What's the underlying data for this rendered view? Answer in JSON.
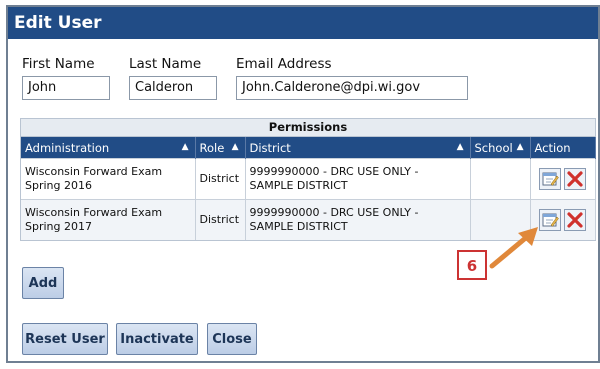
{
  "dialog": {
    "title": "Edit User"
  },
  "user": {
    "first_name_label": "First Name",
    "first_name_value": "John",
    "last_name_label": "Last Name",
    "last_name_value": "Calderon",
    "email_label": "Email Address",
    "email_value": "John.Calderone@dpi.wi.gov"
  },
  "permissions": {
    "title": "Permissions",
    "columns": [
      "Administration",
      "Role",
      "District",
      "School",
      "Action"
    ],
    "rows": [
      {
        "administration": "Wisconsin Forward Exam Spring 2016",
        "role": "District",
        "district": "9999990000 - DRC USE ONLY - SAMPLE DISTRICT",
        "school": ""
      },
      {
        "administration": "Wisconsin Forward Exam Spring 2017",
        "role": "District",
        "district": "9999990000 - DRC USE ONLY - SAMPLE DISTRICT",
        "school": ""
      }
    ],
    "action_icons": [
      "edit-icon",
      "delete-icon"
    ]
  },
  "buttons": {
    "add": "Add",
    "reset_user": "Reset User",
    "inactivate": "Inactivate",
    "close": "Close"
  },
  "annotation": {
    "callout": "6"
  },
  "colors": {
    "header": "#214c86",
    "callout": "#cc3333",
    "arrow": "#e0883a"
  }
}
